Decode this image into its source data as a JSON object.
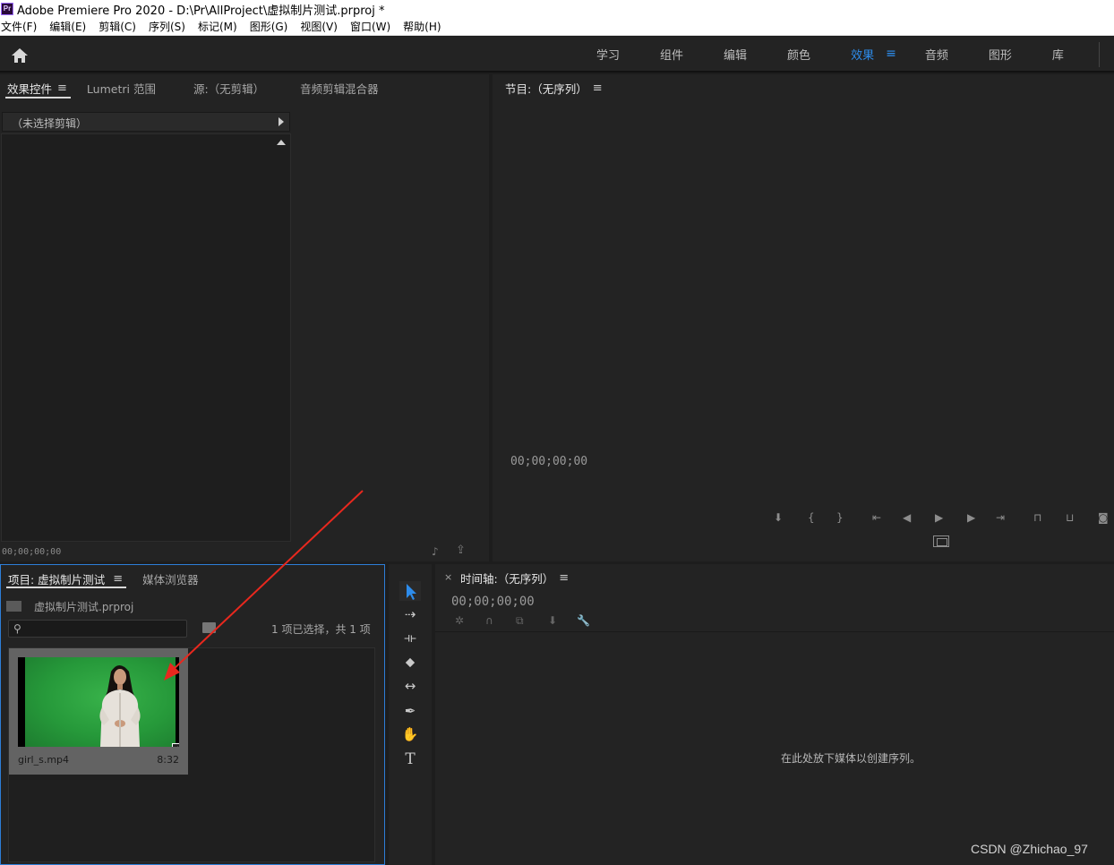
{
  "window": {
    "title": "Adobe Premiere Pro 2020 - D:\\Pr\\AllProject\\虚拟制片测试.prproj *",
    "app_icon_label": "Pr"
  },
  "menu": [
    "文件(F)",
    "编辑(E)",
    "剪辑(C)",
    "序列(S)",
    "标记(M)",
    "图形(G)",
    "视图(V)",
    "窗口(W)",
    "帮助(H)"
  ],
  "workspaces": {
    "tabs": [
      "学习",
      "组件",
      "编辑",
      "颜色",
      "效果",
      "音频",
      "图形",
      "库"
    ],
    "active": "效果",
    "menu_icon": "≡"
  },
  "effects_panel": {
    "tabs": [
      "效果控件",
      "Lumetri 范围",
      "源:（无剪辑）",
      "音频剪辑混合器"
    ],
    "active_tab": "效果控件",
    "menu_icon": "≡",
    "clip_selector": "（未选择剪辑）",
    "timecode": "00;00;00;00"
  },
  "program_panel": {
    "title": "节目:（无序列）",
    "menu_icon": "≡",
    "timecode": "00;00;00;00"
  },
  "project_panel": {
    "tabs": [
      "项目: 虚拟制片测试",
      "媒体浏览器"
    ],
    "menu_icon": "≡",
    "file_name": "虚拟制片测试.prproj",
    "search_placeholder": "",
    "selection_count": "1 项已选择，共 1 项",
    "clip": {
      "name": "girl_s.mp4",
      "duration": "8:32"
    }
  },
  "timeline_panel": {
    "close_icon": "×",
    "title": "时间轴:（无序列）",
    "menu_icon": "≡",
    "timecode": "00;00;00;00",
    "drop_hint": "在此处放下媒体以创建序列。"
  },
  "watermark": "CSDN @Zhichao_97",
  "colors": {
    "accent": "#2d8ceb",
    "panel_bg": "#232323",
    "annotation_arrow": "#e8281e",
    "greenscreen": "#2fa642"
  }
}
